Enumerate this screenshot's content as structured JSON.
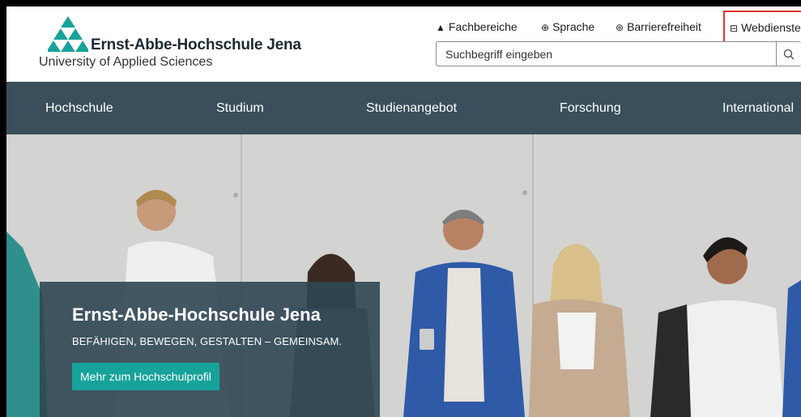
{
  "brand": {
    "name": "Ernst-Abbe-Hochschule Jena",
    "subtitle": "University of Applied Sciences",
    "accent_color": "#17a39a"
  },
  "topnav": {
    "items": [
      {
        "label": "Fachbereiche",
        "icon": "triangle-icon"
      },
      {
        "label": "Sprache",
        "icon": "globe-icon"
      },
      {
        "label": "Barrierefreiheit",
        "icon": "accessibility-icon"
      },
      {
        "label": "Webdienste",
        "icon": "window-icon"
      }
    ]
  },
  "search": {
    "placeholder": "Suchbegriff eingeben",
    "icon": "search-icon"
  },
  "mainnav": {
    "background": "#3a4f5b",
    "items": [
      {
        "label": "Hochschule"
      },
      {
        "label": "Studium"
      },
      {
        "label": "Studienangebot"
      },
      {
        "label": "Forschung"
      },
      {
        "label": "International"
      }
    ]
  },
  "hero": {
    "title": "Ernst-Abbe-Hochschule Jena",
    "subtitle": "BEFÄHIGEN, BEWEGEN, GESTALTEN – GEMEINSAM.",
    "button_label": "Mehr zum Hochschulprofil",
    "image": "group-of-students-against-concrete-wall"
  }
}
